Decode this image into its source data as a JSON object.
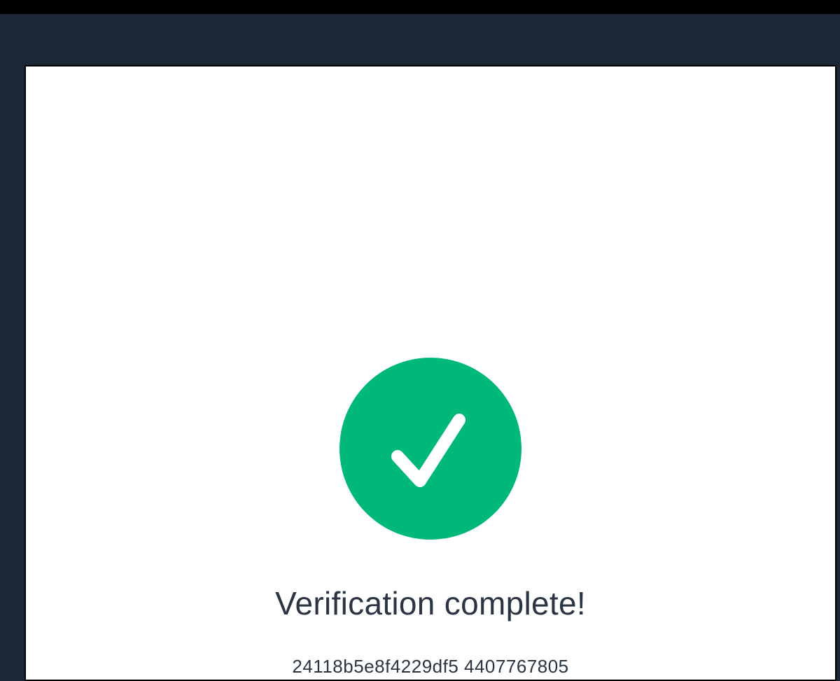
{
  "verification": {
    "status_icon": "checkmark-icon",
    "status_color": "#00b87a",
    "title": "Verification complete!",
    "code": "24118b5e8f4229df5 4407767805"
  },
  "colors": {
    "backdrop": "#1c2836",
    "card": "#ffffff",
    "text": "#2b3442"
  }
}
